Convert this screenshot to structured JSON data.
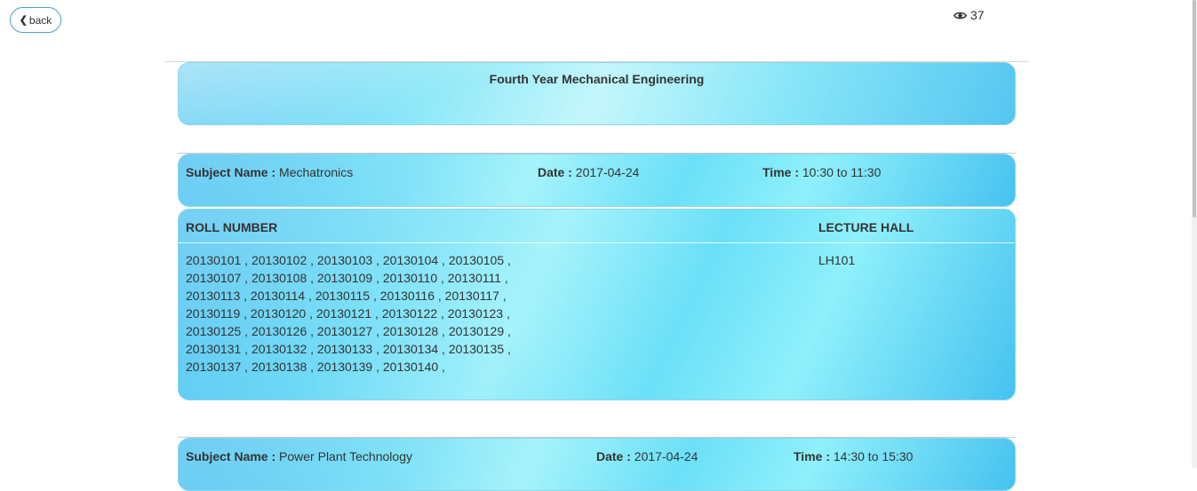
{
  "nav": {
    "back_label": "back"
  },
  "views": {
    "count": "37"
  },
  "exam": {
    "title": "Fourth Year Mechanical Engineering"
  },
  "labels": {
    "subject": "Subject Name :",
    "date": "Date :",
    "time": "Time :",
    "roll_header": "ROLL NUMBER",
    "hall_header": "LECTURE HALL"
  },
  "subjects": [
    {
      "name": "Mechatronics",
      "date": "2017-04-24",
      "time": "10:30 to 11:30",
      "roll_lines": [
        "20130101 , 20130102 , 20130103 , 20130104 , 20130105 ,",
        "20130107 , 20130108 , 20130109 , 20130110 , 20130111 ,",
        "20130113 , 20130114 , 20130115 , 20130116 , 20130117 ,",
        "20130119 , 20130120 , 20130121 , 20130122 , 20130123 ,",
        "20130125 , 20130126 , 20130127 , 20130128 , 20130129 ,",
        "20130131 , 20130132 , 20130133 , 20130134 , 20130135 ,",
        "20130137 , 20130138 , 20130139 , 20130140 ,"
      ],
      "hall": "LH101"
    },
    {
      "name": "Power Plant Technology",
      "date": "2017-04-24",
      "time": "14:30 to 15:30"
    }
  ]
}
